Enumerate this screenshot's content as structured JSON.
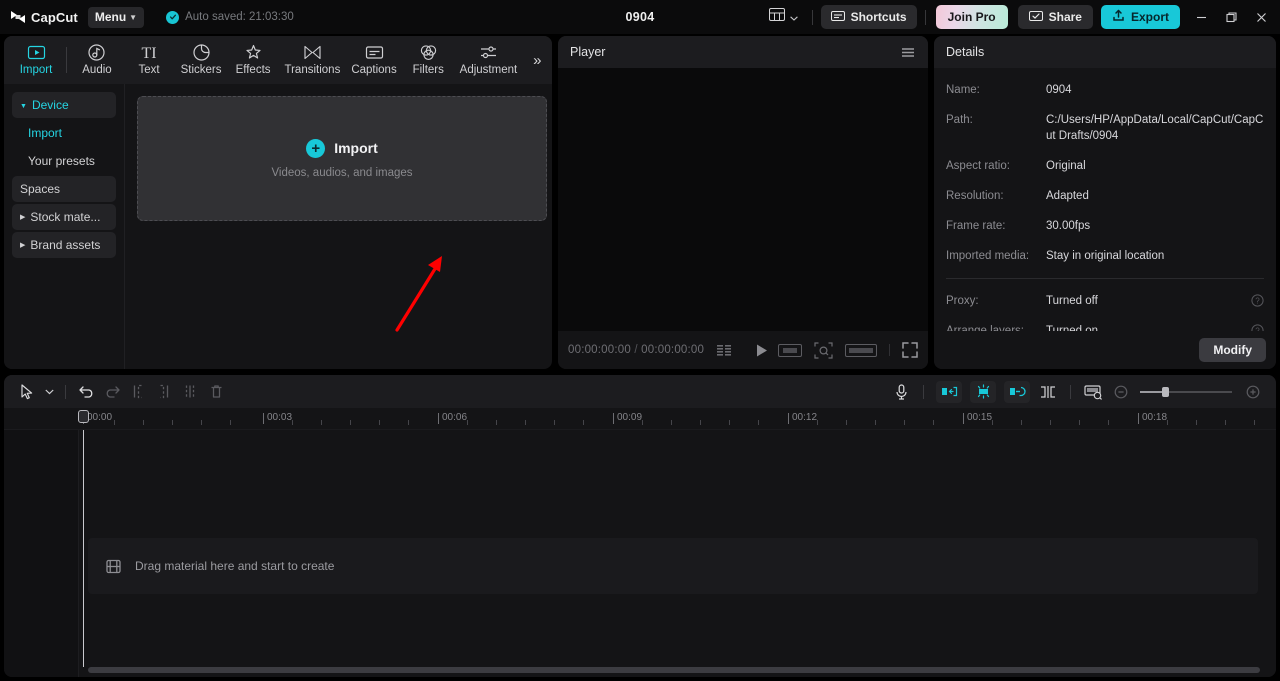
{
  "app": {
    "brand": "CapCut",
    "menu_label": "Menu",
    "autosave_text": "Auto saved: 21:03:30",
    "project_title": "0904",
    "accent": "#18c8d8",
    "annotation_arrow_color": "#ff0000"
  },
  "titlebar": {
    "layout_icon": "layout-grid-icon",
    "shortcuts_label": "Shortcuts",
    "join_pro_label": "Join Pro",
    "share_label": "Share",
    "export_label": "Export",
    "minimize": "minimize-icon",
    "maximize": "restore-icon",
    "close": "close-icon"
  },
  "function_tabs": [
    {
      "label": "Import",
      "icon": "import-icon",
      "active": true
    },
    {
      "label": "Audio",
      "icon": "audio-icon",
      "active": false
    },
    {
      "label": "Text",
      "icon": "text-icon",
      "active": false
    },
    {
      "label": "Stickers",
      "icon": "stickers-icon",
      "active": false
    },
    {
      "label": "Effects",
      "icon": "effects-icon",
      "active": false
    },
    {
      "label": "Transitions",
      "icon": "transitions-icon",
      "active": false
    },
    {
      "label": "Captions",
      "icon": "captions-icon",
      "active": false
    },
    {
      "label": "Filters",
      "icon": "filters-icon",
      "active": false
    },
    {
      "label": "Adjustment",
      "icon": "adjustment-icon",
      "active": false
    }
  ],
  "function_tabs_more": "»",
  "sidebar": {
    "items": [
      {
        "label": "Device",
        "type": "group",
        "expanded": true,
        "selected": true
      },
      {
        "label": "Import",
        "type": "sub",
        "selected": true
      },
      {
        "label": "Your presets",
        "type": "sub",
        "selected": false
      },
      {
        "label": "Spaces",
        "type": "boxed",
        "selected": false
      },
      {
        "label": "Stock mate...",
        "type": "group-collapsed",
        "selected": false
      },
      {
        "label": "Brand assets",
        "type": "group-collapsed",
        "selected": false
      }
    ]
  },
  "dropzone": {
    "title": "Import",
    "subtitle": "Videos, audios, and images",
    "plus_icon": "plus-circle-icon"
  },
  "player": {
    "title": "Player",
    "menu_icon": "hamburger-icon",
    "current_time": "00:00:00:00",
    "separator": "/",
    "total_time": "00:00:00:00",
    "controls": [
      {
        "icon": "quality-icon"
      },
      {
        "icon": "play-icon"
      },
      {
        "icon": "aspect-ratio-icon"
      },
      {
        "icon": "zoom-fit-icon"
      },
      {
        "icon": "resolution-icon"
      },
      {
        "icon": "fullscreen-icon"
      }
    ]
  },
  "details": {
    "title": "Details",
    "rows": [
      {
        "label": "Name:",
        "value": "0904",
        "help": false
      },
      {
        "label": "Path:",
        "value": "C:/Users/HP/AppData/Local/CapCut/CapCut Drafts/0904",
        "help": false
      },
      {
        "label": "Aspect ratio:",
        "value": "Original",
        "help": false
      },
      {
        "label": "Resolution:",
        "value": "Adapted",
        "help": false
      },
      {
        "label": "Frame rate:",
        "value": "30.00fps",
        "help": false
      },
      {
        "label": "Imported media:",
        "value": "Stay in original location",
        "help": false
      }
    ],
    "rows_after_divider": [
      {
        "label": "Proxy:",
        "value": "Turned off",
        "help": true
      },
      {
        "label": "Arrange layers:",
        "value": "Turned on",
        "help": true
      }
    ],
    "modify_label": "Modify"
  },
  "timeline": {
    "toolbar_left": [
      {
        "icon": "select-tool-icon",
        "state": "active"
      },
      {
        "icon": "chevron-down-icon",
        "state": "active"
      },
      {
        "icon": "undo-icon",
        "state": "active"
      },
      {
        "icon": "redo-icon",
        "state": "disabled"
      },
      {
        "icon": "split-left-icon",
        "state": "disabled"
      },
      {
        "icon": "split-right-icon",
        "state": "disabled"
      },
      {
        "icon": "split-icon",
        "state": "disabled"
      },
      {
        "icon": "delete-icon",
        "state": "disabled"
      }
    ],
    "toolbar_right": [
      {
        "icon": "microphone-icon",
        "state": "active"
      },
      {
        "icon": "auto-cutout-icon",
        "state": "highlighted"
      },
      {
        "icon": "auto-beat-icon",
        "state": "highlighted"
      },
      {
        "icon": "link-icon",
        "state": "highlighted"
      },
      {
        "icon": "mirror-icon",
        "state": "active"
      },
      {
        "icon": "crop-preview-icon",
        "state": "active"
      },
      {
        "icon": "zoom-out-icon",
        "state": "dim"
      },
      {
        "icon": "zoom-in-icon",
        "state": "dim"
      }
    ],
    "ruler_labels": [
      "00:00",
      "00:03",
      "00:06",
      "00:09",
      "00:12",
      "00:15",
      "00:18"
    ],
    "playhead_time": "00:00",
    "empty_track_text": "Drag material here and start to create",
    "empty_track_icon": "media-placeholder-icon",
    "zoom_value": 20
  }
}
